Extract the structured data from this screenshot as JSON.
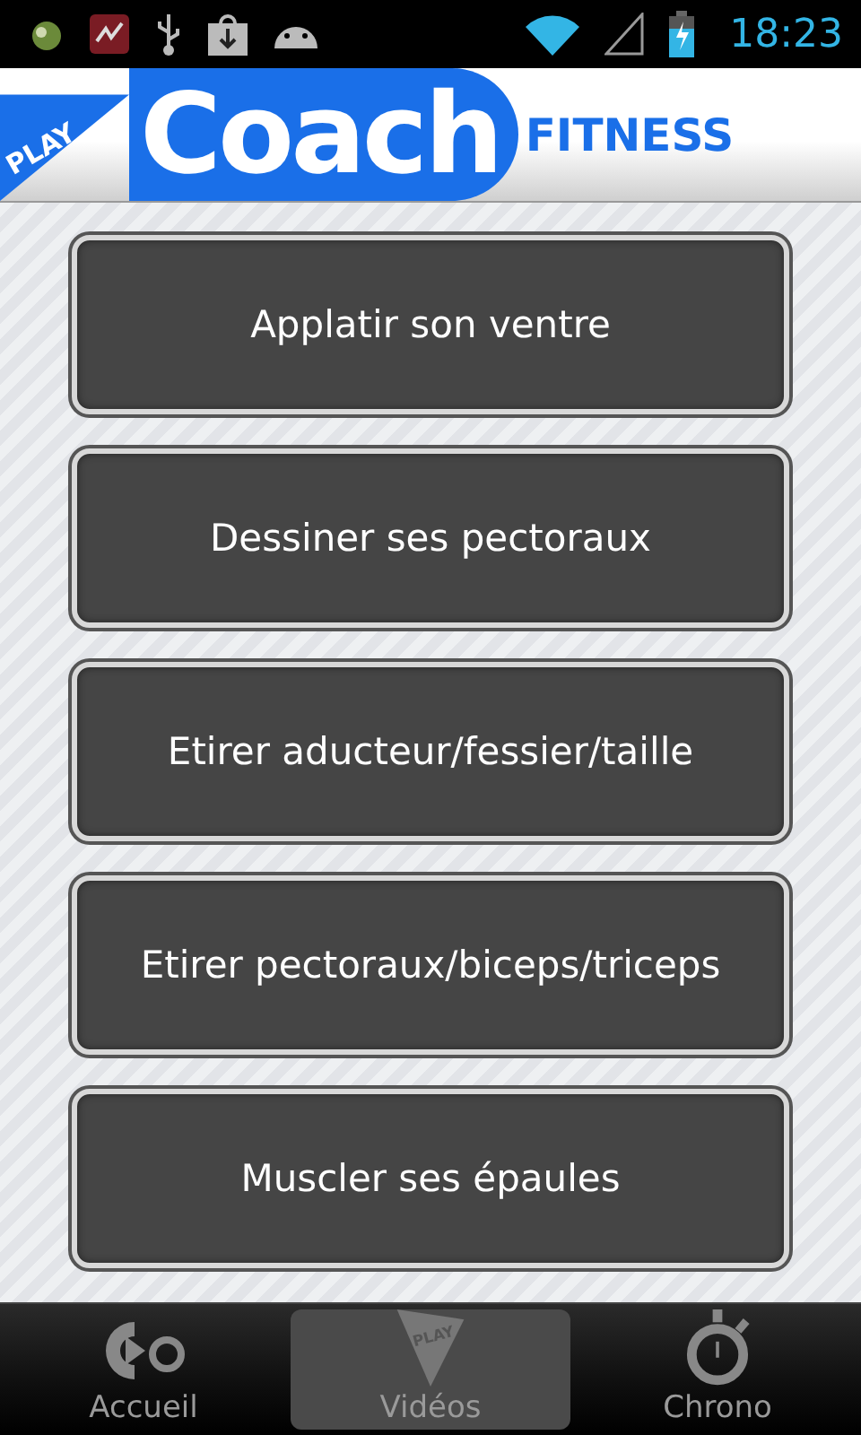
{
  "status_bar": {
    "time": "18:23"
  },
  "header": {
    "logo_play": "PLAY",
    "logo_main": "Coach",
    "logo_sub": "FITNESS"
  },
  "menu": [
    {
      "label": "Applatir son ventre"
    },
    {
      "label": "Dessiner ses pectoraux"
    },
    {
      "label": "Etirer aducteur/fessier/taille"
    },
    {
      "label": "Etirer pectoraux/biceps/triceps"
    },
    {
      "label": "Muscler ses épaules"
    }
  ],
  "tabs": [
    {
      "label": "Accueil",
      "kind": "home",
      "selected": false
    },
    {
      "label": "Vidéos",
      "kind": "videos",
      "icon_text": "PLAY",
      "selected": true
    },
    {
      "label": "Chrono",
      "kind": "chrono",
      "selected": false
    }
  ]
}
